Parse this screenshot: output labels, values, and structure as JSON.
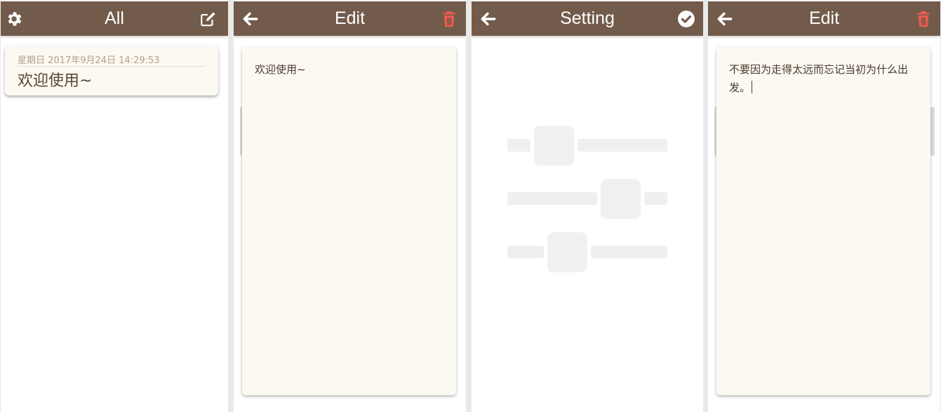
{
  "screens": {
    "list": {
      "title": "All",
      "left_icon": "gear-icon",
      "right_icon": "edit-icon",
      "notes": [
        {
          "date": "星期日 2017年9月24日 14:29:53",
          "text": "欢迎使用~"
        }
      ]
    },
    "edit1": {
      "title": "Edit",
      "left_icon": "back-arrow-icon",
      "right_icon": "trash-icon",
      "content": "欢迎使用~"
    },
    "setting": {
      "title": "Setting",
      "left_icon": "back-arrow-icon",
      "right_icon": "check-circle-icon",
      "placeholder_icon": "sliders-icon"
    },
    "edit2": {
      "title": "Edit",
      "left_icon": "back-arrow-icon",
      "right_icon": "trash-icon",
      "content": "不要因为走得太远而忘记当初为什么出发。"
    }
  },
  "colors": {
    "topbar": "#725b4b",
    "paper": "#fbf9f1",
    "delete": "#f25b4f",
    "text": "#4a3a2f"
  }
}
